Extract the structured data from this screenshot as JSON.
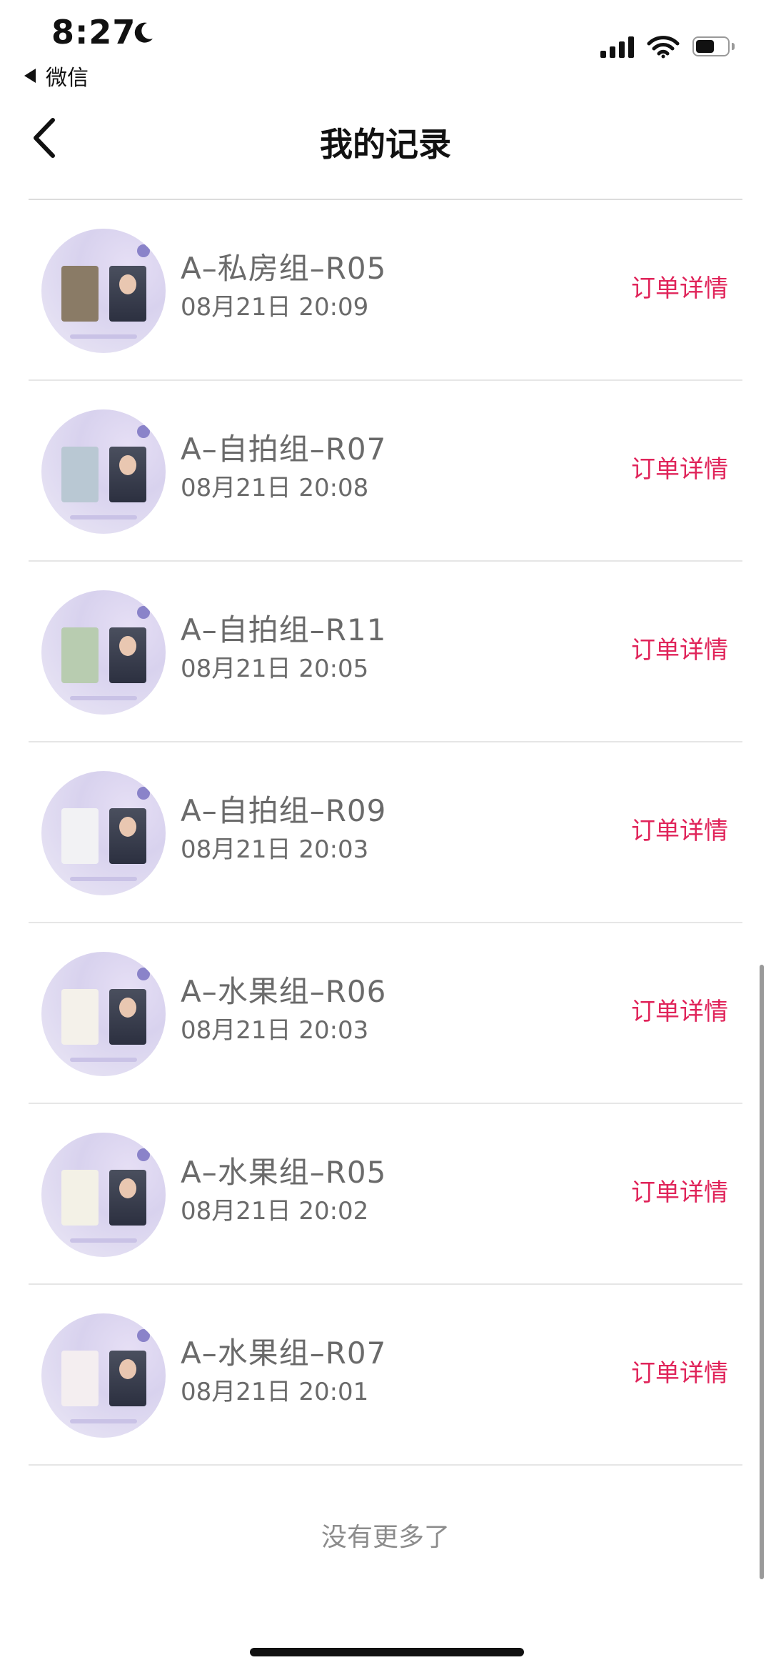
{
  "status_bar": {
    "time": "8:27",
    "back_app_label": "微信",
    "battery_level": 0.6
  },
  "nav": {
    "title": "我的记录"
  },
  "records": [
    {
      "name": "A–私房组–R05",
      "date": "08月21日 20:09",
      "detail_label": "订单详情",
      "card_a_color": "#8a7b66"
    },
    {
      "name": "A–自拍组–R07",
      "date": "08月21日 20:08",
      "detail_label": "订单详情",
      "card_a_color": "#b9c8d3"
    },
    {
      "name": "A–自拍组–R11",
      "date": "08月21日 20:05",
      "detail_label": "订单详情",
      "card_a_color": "#b8ccb0"
    },
    {
      "name": "A–自拍组–R09",
      "date": "08月21日 20:03",
      "detail_label": "订单详情",
      "card_a_color": "#f2f2f4"
    },
    {
      "name": "A–水果组–R06",
      "date": "08月21日 20:03",
      "detail_label": "订单详情",
      "card_a_color": "#f4f1ea"
    },
    {
      "name": "A–水果组–R05",
      "date": "08月21日 20:02",
      "detail_label": "订单详情",
      "card_a_color": "#f3f1e6"
    },
    {
      "name": "A–水果组–R07",
      "date": "08月21日 20:01",
      "detail_label": "订单详情",
      "card_a_color": "#f4eef0"
    }
  ],
  "footer": {
    "no_more_text": "没有更多了"
  },
  "colors": {
    "accent": "#e0245a",
    "text_secondary": "#6a6a6a"
  }
}
